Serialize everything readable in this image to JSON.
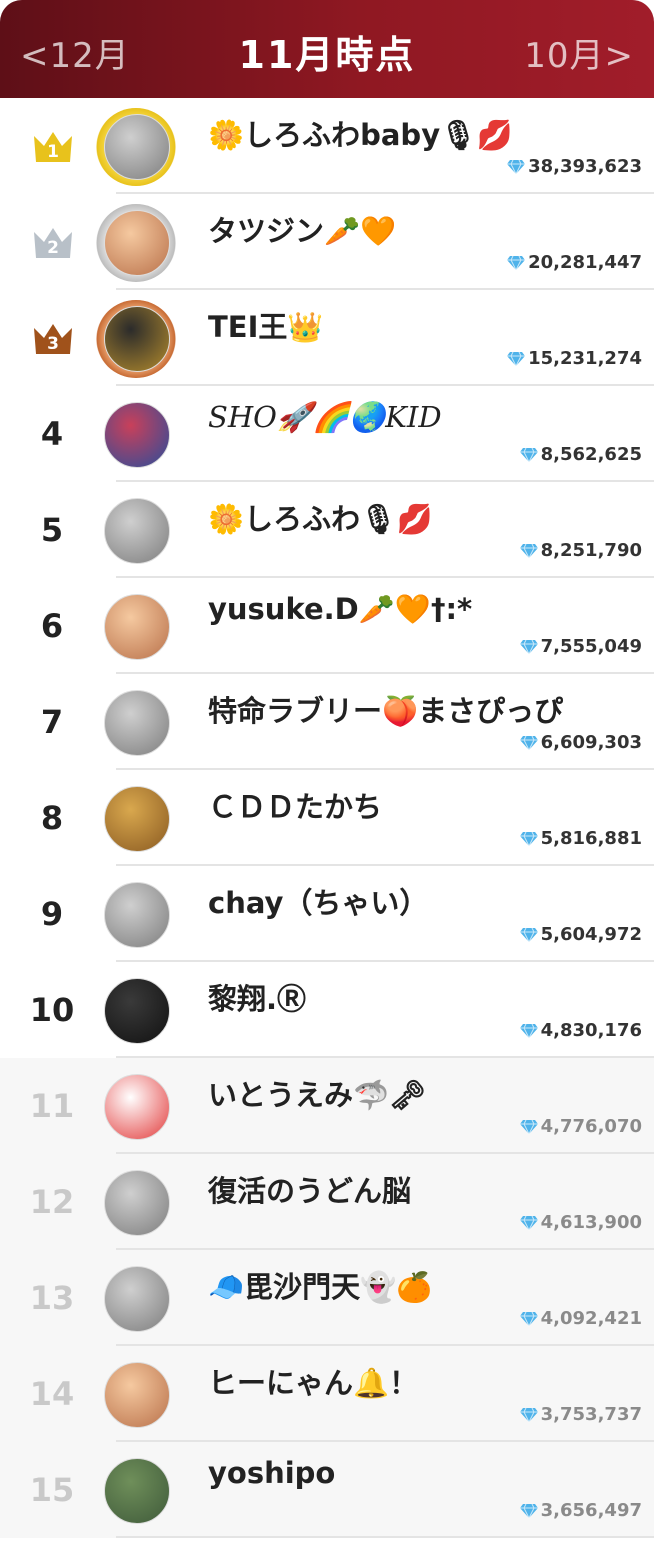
{
  "header": {
    "prev_label": "<12月",
    "title": "11月時点",
    "next_label": "10月>"
  },
  "colors": {
    "header_start": "#5e0f17",
    "header_end": "#a11d2a",
    "gold": "#e8c21c",
    "silver": "#b8c0c8",
    "bronze": "#a0521b",
    "gem": "#4fb3ea"
  },
  "rankings": [
    {
      "rank": "1",
      "name": "🌼しろふわbaby🎙💋",
      "score": "38,393,623",
      "tier": "gold",
      "avatar": "avatar-photo"
    },
    {
      "rank": "2",
      "name": "タツジン🥕🧡",
      "score": "20,281,447",
      "tier": "silver",
      "avatar": "avatar-illustration"
    },
    {
      "rank": "3",
      "name": "TEI王👑",
      "score": "15,231,274",
      "tier": "bronze",
      "avatar": "avatar-emblem"
    },
    {
      "rank": "4",
      "name": "𝑆𝐻𝑂🚀🌈🌏𝐾𝐼𝐷",
      "score": "8,562,625",
      "tier": "none",
      "avatar": "avatar-art"
    },
    {
      "rank": "5",
      "name": "🌼しろふわ🎙💋",
      "score": "8,251,790",
      "tier": "none",
      "avatar": "avatar-photo"
    },
    {
      "rank": "6",
      "name": "yusuke.D🥕🧡†:*",
      "score": "7,555,049",
      "tier": "none",
      "avatar": "avatar-illustration"
    },
    {
      "rank": "7",
      "name": "特命ラブリー🍑まさぴっぴ",
      "score": "6,609,303",
      "tier": "none",
      "avatar": "avatar-photo"
    },
    {
      "rank": "8",
      "name": "ＣＤＤたかち",
      "score": "5,816,881",
      "tier": "none",
      "avatar": "avatar-bear"
    },
    {
      "rank": "9",
      "name": "chay（ちゃい）",
      "score": "5,604,972",
      "tier": "none",
      "avatar": "avatar-photo"
    },
    {
      "rank": "10",
      "name": "黎翔.Ⓡ",
      "score": "4,830,176",
      "tier": "none",
      "avatar": "avatar-calligraphy"
    },
    {
      "rank": "11",
      "name": "いとうえみ🦈🗝",
      "score": "4,776,070",
      "tier": "dim",
      "avatar": "avatar-cartoon"
    },
    {
      "rank": "12",
      "name": "復活のうどん脳",
      "score": "4,613,900",
      "tier": "dim",
      "avatar": "avatar-photo"
    },
    {
      "rank": "13",
      "name": "🧢毘沙門天👻🍊",
      "score": "4,092,421",
      "tier": "dim",
      "avatar": "avatar-photo"
    },
    {
      "rank": "14",
      "name": "ヒーにゃん🔔！",
      "score": "3,753,737",
      "tier": "dim",
      "avatar": "avatar-illustration"
    },
    {
      "rank": "15",
      "name": "yoshipo",
      "score": "3,656,497",
      "tier": "dim",
      "avatar": "avatar-landscape"
    }
  ]
}
